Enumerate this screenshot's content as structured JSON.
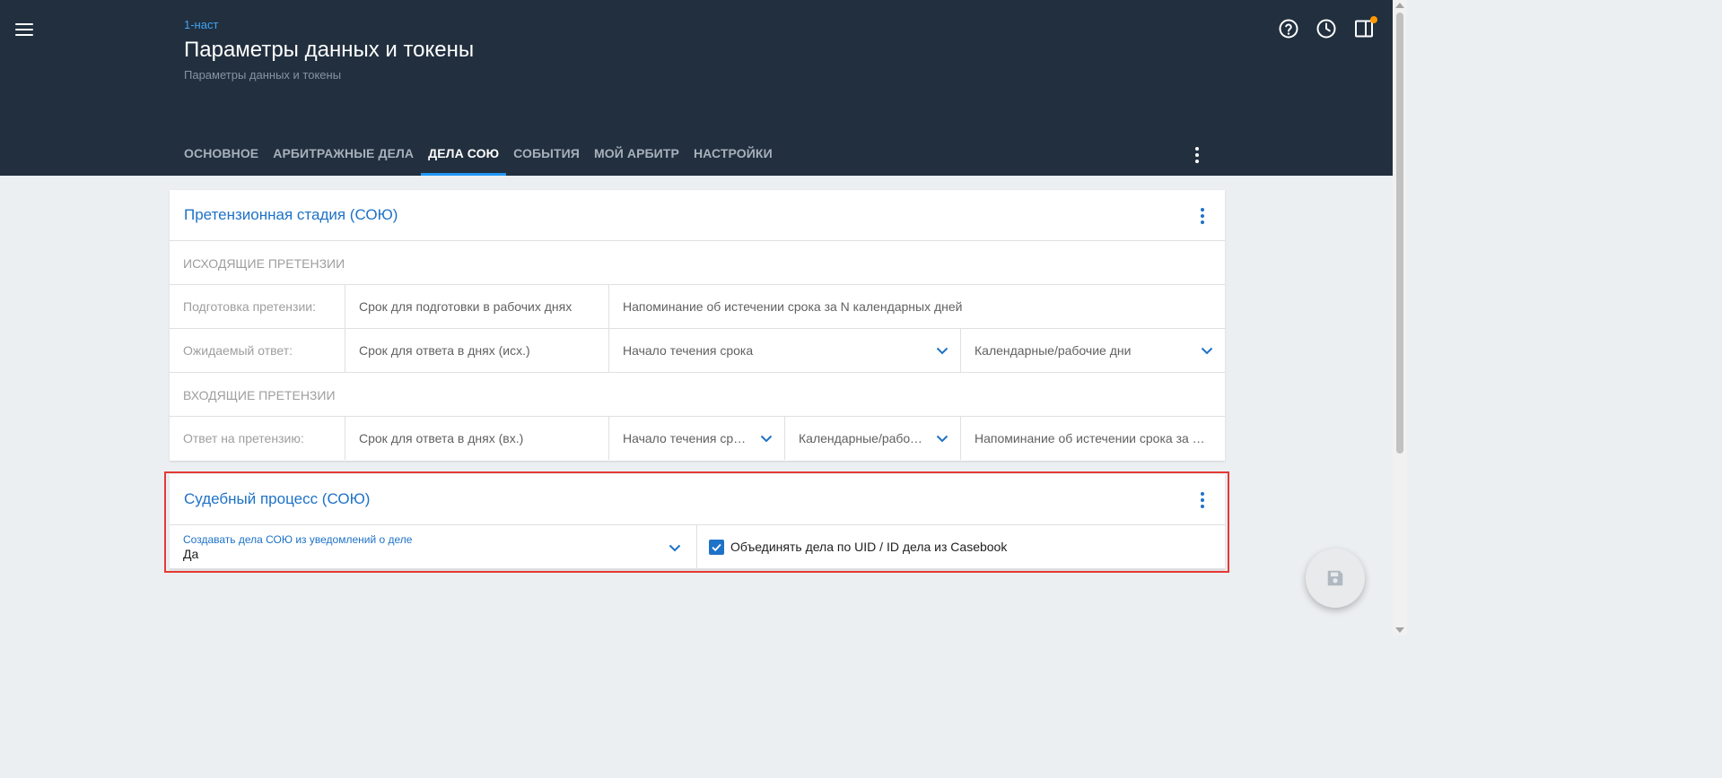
{
  "header": {
    "breadcrumb": "1-наст",
    "title": "Параметры данных и токены",
    "subtitle": "Параметры данных и токены",
    "icons": [
      "help-circle-icon",
      "history-clock-icon",
      "panel-notification-icon"
    ],
    "notification_dot_color": "#ff9800"
  },
  "tabs": [
    {
      "label": "ОСНОВНОЕ",
      "active": false
    },
    {
      "label": "АРБИТРАЖНЫЕ ДЕЛА",
      "active": false
    },
    {
      "label": "ДЕЛА СОЮ",
      "active": true
    },
    {
      "label": "СОБЫТИЯ",
      "active": false
    },
    {
      "label": "МОЙ АРБИТР",
      "active": false
    },
    {
      "label": "НАСТРОЙКИ",
      "active": false
    }
  ],
  "claims_card": {
    "title": "Претензионная стадия (СОЮ)",
    "outgoing_section": "ИСХОДЯЩИЕ ПРЕТЕНЗИИ",
    "prep_row": {
      "label": "Подготовка претензии:",
      "deadline_placeholder": "Срок для подготовки в рабочих днях",
      "reminder_placeholder": "Напоминание об истечении срока за N календарных дней"
    },
    "expected_row": {
      "label": "Ожидаемый ответ:",
      "deadline_placeholder": "Срок для ответа в днях (исх.)",
      "start_select": "Начало течения срока",
      "days_select": "Календарные/рабочие дни"
    },
    "incoming_section": "ВХОДЯЩИЕ ПРЕТЕНЗИИ",
    "answer_row": {
      "label": "Ответ на претензию:",
      "deadline_placeholder": "Срок для ответа в днях (вх.)",
      "start_select": "Начало течения срока",
      "days_select": "Календарные/рабочие дни",
      "reminder_placeholder": "Напоминание об истечении срока за N календарных дней"
    }
  },
  "court_card": {
    "title": "Судебный процесс (СОЮ)",
    "create_cases_label": "Создавать дела СОЮ из уведомлений о деле",
    "create_cases_value": "Да",
    "merge_label": "Объединять дела по UID / ID дела из Casebook",
    "merge_checked": true
  },
  "fab": {
    "icon": "save-icon"
  },
  "colors": {
    "header_bg": "#212f3e",
    "accent": "#1e72c7",
    "tab_indicator": "#2196f3",
    "highlight_border": "#e53935",
    "page_bg": "#eceff1"
  }
}
